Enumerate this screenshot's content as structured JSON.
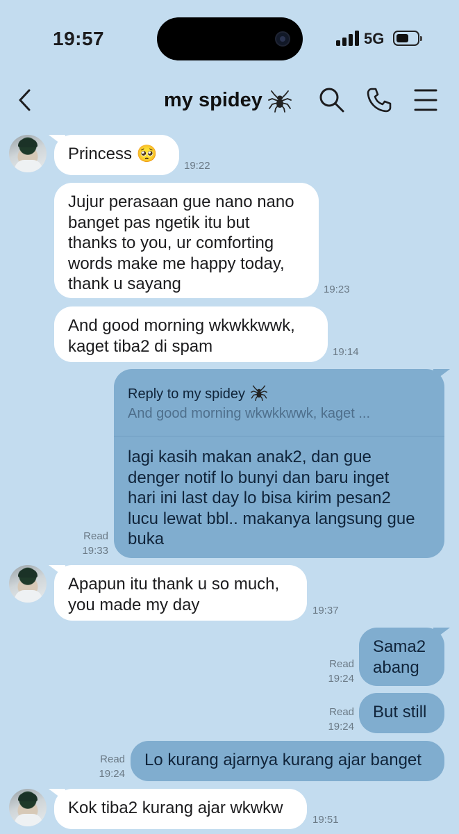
{
  "status_bar": {
    "time": "19:57",
    "network": "5G",
    "battery_level": 0.6
  },
  "header": {
    "title": "my spidey",
    "title_emoji_icon": "spider-icon"
  },
  "messages": [
    {
      "side": "in",
      "text": "Princess 🥺",
      "time": "19:22"
    },
    {
      "side": "in",
      "text": "Jujur perasaan gue nano nano\nbanget pas ngetik itu but\nthanks to you, ur comforting\nwords make me happy today,\nthank u sayang",
      "time": "19:23"
    },
    {
      "side": "in",
      "text": "And good morning wkwkkwwk,\nkaget tiba2 di spam",
      "time": "19:14"
    },
    {
      "side": "out",
      "reply_label": "Reply to my spidey",
      "reply_quote": "And good morning wkwkkwwk, kaget ...",
      "text": "lagi kasih makan anak2, dan gue\ndenger notif lo bunyi dan baru inget\nhari ini last day lo bisa kirim pesan2\nlucu lewat bbl.. makanya langsung gue\nbuka",
      "status": "Read",
      "time": "19:33"
    },
    {
      "side": "in",
      "text": "Apapun itu thank u so much,\nyou made my day",
      "time": "19:37"
    },
    {
      "side": "out",
      "text": "Sama2\nabang",
      "status": "Read",
      "time": "19:24"
    },
    {
      "side": "out",
      "text": "But still",
      "status": "Read",
      "time": "19:24"
    },
    {
      "side": "out",
      "text": "Lo kurang ajarnya kurang ajar banget",
      "status": "Read",
      "time": "19:24"
    },
    {
      "side": "in",
      "text": "Kok tiba2 kurang ajar wkwkw",
      "time": "19:51"
    }
  ],
  "colors": {
    "background": "#c3dcef",
    "incoming_bubble": "#ffffff",
    "outgoing_bubble": "#80adcf"
  }
}
